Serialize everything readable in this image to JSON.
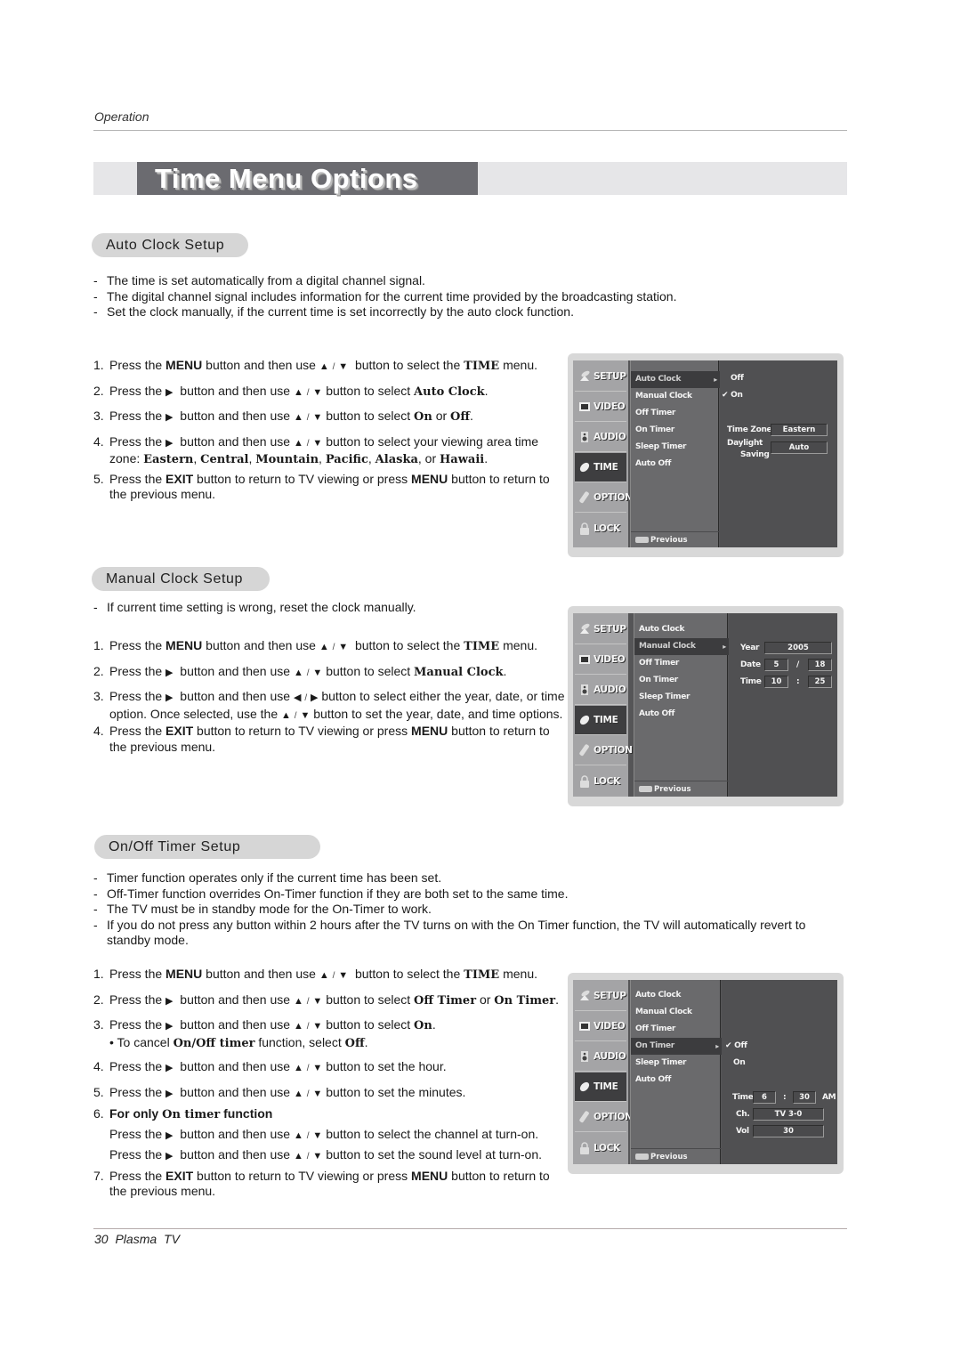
{
  "header": {
    "section": "Operation"
  },
  "title": "Time Menu Options",
  "footer": {
    "page_number": "30",
    "product": "Plasma TV"
  },
  "arrows": {
    "up": "▲",
    "down": "▼",
    "left": "◀",
    "right": "▶",
    "sep": "/"
  },
  "sections": {
    "auto_clock": {
      "heading": "Auto Clock Setup",
      "bullets": [
        "The time is set automatically from a digital channel signal.",
        "The digital channel signal includes information for the current time provided by the broadcasting station.",
        "Set the clock manually, if the current time is set incorrectly by the auto clock function."
      ],
      "steps": [
        "1. Press the MENU button and then use ▲ / ▼ button to select the TIME menu.",
        "2. Press the ▶ button and then use ▲ / ▼ button to select Auto Clock.",
        "3. Press the ▶ button and then use ▲ / ▼ button to select On or Off.",
        "4. Press the ▶ button and then use ▲ / ▼ button to select your viewing area time zone: Eastern, Central, Mountain, Pacific, Alaska, or Hawaii.",
        "5. Press EXIT button to return to TV viewing or press MENU button to return to the previous menu."
      ]
    },
    "manual_clock": {
      "heading": "Manual Clock Setup",
      "bullets": [
        "If current time setting is wrong, reset the clock manually."
      ],
      "steps": [
        "1. Press the MENU button and then use ▲ / ▼ button to select the TIME menu.",
        "2. Press the ▶ button and then use ▲ / ▼ button to select Manual Clock.",
        "3. Press the ▶ button and then use ◀ / ▶ button to select either the year, date, or time option. Once selected, use the ▲ / ▼ button to set the year, date, and time options.",
        "4. Press EXIT button to return to TV viewing or press MENU button to return to the previous menu."
      ]
    },
    "onoff_timer": {
      "heading": "On/Off Timer Setup",
      "bullets": [
        "Timer function operates only if the current time has been set.",
        "Off-Timer function overrides On-Timer function if they are both set to the same time.",
        "The TV must be in standby mode for the On-Timer to work.",
        "If you do not press any button within 2 hours after the TV turns on with the On Timer function, the TV will automatically revert to standby mode."
      ],
      "steps": [
        "1. Press the MENU button and then use ▲ / ▼ button to select the TIME menu.",
        "2. Press the ▶ button and then use ▲ / ▼ button to select Off Timer or On Timer.",
        "3. Press the ▶ button and then use ▲ / ▼ button to select On. • To cancel On/Off timer function, select Off.",
        "4. Press the ▶ button and then use ▲ / ▼ button to set the hour.",
        "5. Press the ▶ button and then use ▲ / ▼ button to set the minutes.",
        "6. For only On timer function — Press the ▶ button and then use ▲ / ▼ button to select the channel at turn-on. Press the ▶ button and then use ▲ / ▼ button to set the sound level at turn-on.",
        "7. Press EXIT button to return to TV viewing or press MENU button to return to the previous menu."
      ]
    }
  },
  "words": {
    "press_the": "Press the",
    "menu": "MENU",
    "exit": "EXIT",
    "time": "TIME",
    "btn_then_use": "button and then use",
    "btn_select_the": "button to select the",
    "menu_word": "menu.",
    "btn_select": "button to select",
    "auto_clock": "Auto Clock",
    "manual_clock": "Manual Clock",
    "on": "On",
    "off": "Off",
    "or": "or",
    "tz_tail": "button to select your viewing area time zone:",
    "tz": [
      "Eastern",
      "Central",
      "Mountain",
      "Pacific",
      "Alaska",
      "Hawaii"
    ],
    "exit_tail": "button to return to TV viewing or press",
    "exit_tail2": "button to return to the previous menu.",
    "ms3a": "button to select either the year, date, or time option. Once selected, use the",
    "ms3b": "button to set the year, date, and time options.",
    "off_timer": "Off Timer",
    "on_timer": "On Timer",
    "cancel_pre": "• To cancel",
    "onoff_timer": "On/Off timer",
    "cancel_post": "function, select",
    "set_hour": "button to set the hour.",
    "set_min": "button to set the minutes.",
    "for_only": "For only",
    "on_timer_lc": "On timer",
    "function": "function",
    "sel_channel": "button to select the channel at turn-on.",
    "set_sound": "button to set the sound level at turn-on."
  },
  "osd": {
    "tabs": [
      "SETUP",
      "VIDEO",
      "AUDIO",
      "TIME",
      "OPTION",
      "LOCK"
    ],
    "active_tab": "TIME",
    "items": [
      "Auto Clock",
      "Manual Clock",
      "Off Timer",
      "On Timer",
      "Sleep Timer",
      "Auto Off"
    ],
    "previous": "Previous",
    "panel1": {
      "selected_item": "Auto Clock",
      "options": [
        {
          "label": "Off",
          "checked": false
        },
        {
          "label": "On",
          "checked": true
        }
      ],
      "time_zone_label": "Time Zone",
      "time_zone_value": "Eastern",
      "daylight_label_1": "Daylight",
      "daylight_label_2": "Saving",
      "daylight_value": "Auto"
    },
    "panel2": {
      "selected_item": "Manual Clock",
      "year_label": "Year",
      "year": "2005",
      "date_label": "Date",
      "month": "5",
      "date_sep": "/",
      "day": "18",
      "time_label": "Time",
      "hour": "10",
      "time_sep": ":",
      "minute": "25"
    },
    "panel3": {
      "selected_item": "On Timer",
      "options": [
        {
          "label": "Off",
          "checked": true
        },
        {
          "label": "On",
          "checked": false
        }
      ],
      "time_label": "Time",
      "hour": "6",
      "time_sep": ":",
      "minute": "30",
      "ampm": "AM",
      "ch_label": "Ch.",
      "channel": "TV 3-0",
      "vol_label": "Vol",
      "volume": "30",
      "check": "✔"
    }
  }
}
